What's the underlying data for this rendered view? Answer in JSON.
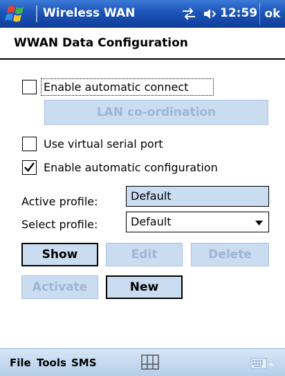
{
  "titlebar": {
    "app_title": "Wireless WAN",
    "time": "12:59",
    "ok_label": "ok",
    "icons": [
      "windows-start-icon",
      "connectivity-icon",
      "volume-icon"
    ]
  },
  "heading": "WWAN Data Configuration",
  "options": {
    "auto_connect": {
      "label": "Enable automatic connect",
      "checked": false
    },
    "virtual_serial": {
      "label": "Use virtual serial port",
      "checked": false
    },
    "auto_config": {
      "label": "Enable automatic configuration",
      "checked": true
    }
  },
  "lan_button": {
    "label": "LAN co-ordination",
    "enabled": false
  },
  "active_profile": {
    "label": "Active profile:",
    "value": "Default"
  },
  "select_profile": {
    "label": "Select profile:",
    "value": "Default"
  },
  "buttons": {
    "show": {
      "label": "Show",
      "enabled": true
    },
    "edit": {
      "label": "Edit",
      "enabled": false
    },
    "delete": {
      "label": "Delete",
      "enabled": false
    },
    "activate": {
      "label": "Activate",
      "enabled": false
    },
    "new": {
      "label": "New",
      "enabled": true
    }
  },
  "menubar": {
    "items": [
      "File",
      "Tools",
      "SMS"
    ],
    "icons": [
      "sip-icon",
      "keyboard-icon"
    ]
  },
  "colors": {
    "titlebar": "#1c54b8",
    "button_face": "#c9dcf0",
    "disabled_text": "#9fb6d3",
    "menubar": "#c4d8ef"
  }
}
